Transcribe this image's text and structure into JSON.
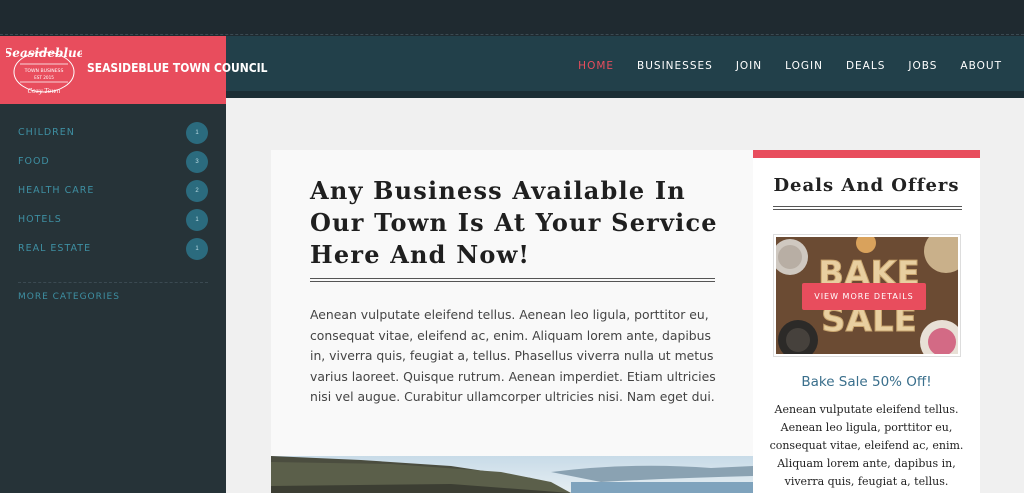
{
  "brand": {
    "name": "SEASIDEBLUE TOWN COUNCIL",
    "badge_title": "Seasideblue",
    "badge_line1": "TOWN BUSINESS",
    "badge_line2": "EST 2015",
    "badge_script": "Cozy Town",
    "color": "#e84d5d"
  },
  "nav": {
    "items": [
      "HOME",
      "BUSINESSES",
      "JOIN",
      "LOGIN",
      "DEALS",
      "JOBS",
      "ABOUT"
    ],
    "active": "HOME",
    "active_color": "#e84d5d"
  },
  "sidebar": {
    "categories": [
      {
        "label": "CHILDREN",
        "count": "1"
      },
      {
        "label": "FOOD",
        "count": "3"
      },
      {
        "label": "HEALTH CARE",
        "count": "2"
      },
      {
        "label": "HOTELS",
        "count": "1"
      },
      {
        "label": "REAL ESTATE",
        "count": "1"
      }
    ],
    "more": "MORE CATEGORIES"
  },
  "main": {
    "headline": "Any Business Available In Our Town Is At Your Service Here And Now!",
    "paragraph": "Aenean vulputate eleifend tellus. Aenean leo ligula, porttitor eu, consequat vitae, eleifend ac, enim. Aliquam lorem ante, dapibus in, viverra quis, feugiat a, tellus. Phasellus viverra nulla ut metus varius laoreet. Quisque rutrum. Aenean imperdiet. Etiam ultricies nisi vel augue. Curabitur ullamcorper ultricies nisi. Nam eget dui."
  },
  "deals": {
    "title": "Deals And Offers",
    "image_text": "BAKE SALE",
    "button": "VIEW MORE DETAILS",
    "item_title": "Bake Sale 50% Off!",
    "item_desc": "Aenean vulputate eleifend tellus. Aenean leo ligula, porttitor eu, consequat vitae, eleifend ac, enim. Aliquam lorem ante, dapibus in, viverra quis, feugiat a, tellus."
  }
}
